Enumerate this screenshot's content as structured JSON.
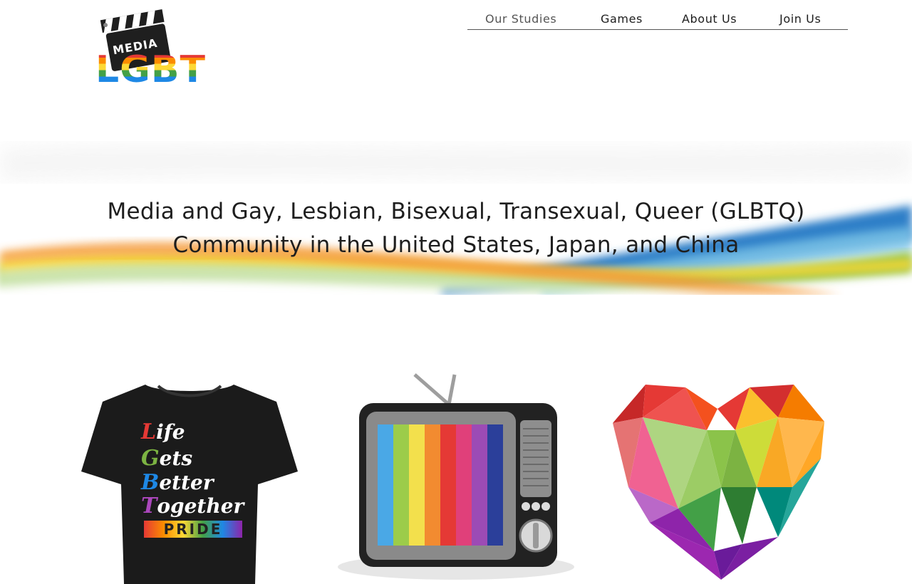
{
  "logo": {
    "top_text": "MEDIA",
    "main_text": "LGBT"
  },
  "nav": {
    "items": [
      {
        "label": "Our Studies",
        "active": true
      },
      {
        "label": "Games",
        "active": false
      },
      {
        "label": "About Us",
        "active": false
      },
      {
        "label": "Join Us",
        "active": false
      }
    ]
  },
  "hero": {
    "title_line1": "Media and Gay, Lesbian, Bisexual, Transexual, Queer (GLBTQ)",
    "title_line2": "Community in the United States, Japan, and China"
  },
  "tiles": {
    "tshirt": {
      "lines": [
        {
          "initial": "L",
          "rest": "ife",
          "color": "#e53935"
        },
        {
          "initial": "G",
          "rest": "ets",
          "color": "#7cb342"
        },
        {
          "initial": "B",
          "rest": "etter",
          "color": "#1e88e5"
        },
        {
          "initial": "T",
          "rest": "ogether",
          "color": "#ab47bc"
        }
      ],
      "banner": "PRIDE"
    },
    "tv": {
      "icon": "retro-tv-icon"
    },
    "heart": {
      "icon": "rainbow-heart-icon"
    }
  },
  "colors": {
    "rainbow": [
      "#e53935",
      "#fb8c00",
      "#fdd835",
      "#43a047",
      "#1e88e5",
      "#8e24aa"
    ],
    "text": "#1e1e1e"
  }
}
